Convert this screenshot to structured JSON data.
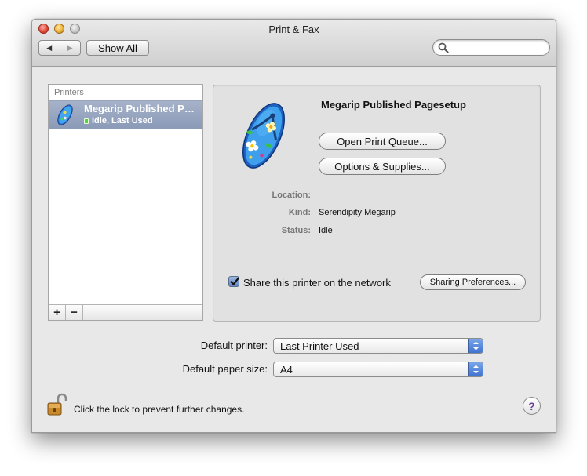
{
  "window": {
    "title": "Print & Fax",
    "show_all_label": "Show All",
    "nav_back": "◀",
    "nav_forward": "▶",
    "search_placeholder": ""
  },
  "printers_list": {
    "header": "Printers",
    "items": [
      {
        "name": "Megarip Published Pagesetup",
        "status": "Idle, Last Used",
        "icon": "flip-flop-icon",
        "selected": true
      }
    ],
    "add_label": "+",
    "remove_label": "−"
  },
  "details": {
    "printer_name": "Megarip Published Pagesetup",
    "open_queue_label": "Open Print Queue...",
    "options_supplies_label": "Options & Supplies...",
    "location_label": "Location:",
    "location_value": "",
    "kind_label": "Kind:",
    "kind_value": "Serendipity Megarip",
    "status_label": "Status:",
    "status_value": "Idle",
    "share_label": "Share this printer on the network",
    "share_checked": true,
    "sharing_prefs_label": "Sharing Preferences..."
  },
  "defaults": {
    "printer_label": "Default printer:",
    "printer_value": "Last Printer Used",
    "paper_label": "Default paper size:",
    "paper_value": "A4"
  },
  "footer": {
    "lock_text": "Click the lock to prevent further changes.",
    "help_label": "?"
  },
  "colors": {
    "selection": "#8a9ab7",
    "popup_arrow": "#3e73d1",
    "window_bg": "#e8e8e8"
  }
}
